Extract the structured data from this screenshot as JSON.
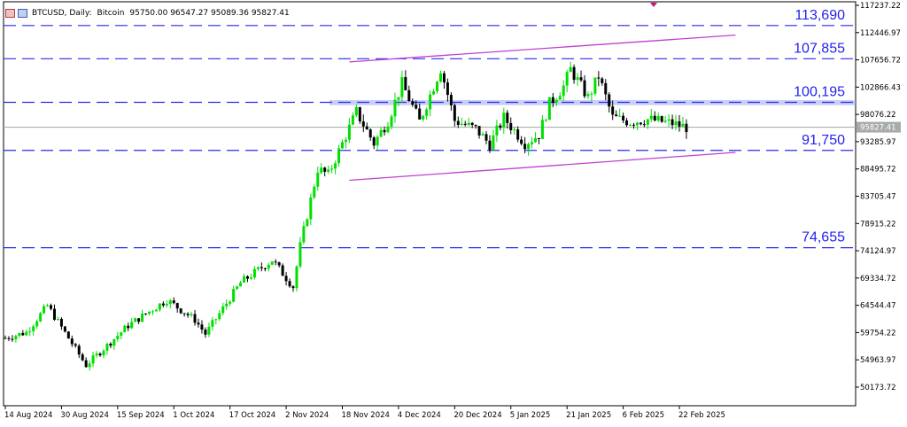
{
  "header": {
    "symbol": "BTCUSD, Daily:",
    "description": "Bitcoin",
    "ohlc": "95750.00 96547.27 95089.36 95827.41"
  },
  "current_price_label": "95827.41",
  "colors": {
    "bull": "#00e000",
    "bear": "#000000",
    "level_line": "#2a2aee",
    "channel": "#c040d0",
    "zone": "#9aa8f0",
    "level_text": "#2222ee",
    "current_line": "#a0a8a0"
  },
  "chart_data": {
    "type": "candlestick",
    "y_axis": {
      "scale": "linear",
      "range": [
        46900,
        117237.22
      ],
      "ticks": [
        "117237.22",
        "112446.97",
        "107656.72",
        "102866.43",
        "98076.22",
        "93285.97",
        "88495.72",
        "83705.47",
        "78915.22",
        "74124.97",
        "69334.72",
        "64544.47",
        "59754.22",
        "54963.97",
        "50173.72"
      ]
    },
    "x_axis": {
      "ticks": [
        "14 Aug 2024",
        "30 Aug 2024",
        "15 Sep 2024",
        "1 Oct 2024",
        "17 Oct 2024",
        "2 Nov 2024",
        "18 Nov 2024",
        "4 Dec 2024",
        "20 Dec 2024",
        "5 Jan 2025",
        "21 Jan 2025",
        "6 Feb 2025",
        "22 Feb 2025"
      ]
    },
    "levels": [
      {
        "label": "113,690",
        "value": 113690
      },
      {
        "label": "107,855",
        "value": 107855
      },
      {
        "label": "100,195",
        "value": 100195
      },
      {
        "label": "91,750",
        "value": 91750
      },
      {
        "label": "74,655",
        "value": 74655
      }
    ],
    "resistance_zone": [
      99700,
      100600
    ],
    "current_price": 95827.41,
    "channel": [
      {
        "from": [
          "2024-11-20",
          107300
        ],
        "to": [
          "2025-03-10",
          112000
        ]
      },
      {
        "from": [
          "2024-11-20",
          86500
        ],
        "to": [
          "2025-03-10",
          91400
        ]
      }
    ],
    "closes_anchor": [
      [
        "2024-08-14",
        58800
      ],
      [
        "2024-08-20",
        59800
      ],
      [
        "2024-08-26",
        64500
      ],
      [
        "2024-09-06",
        54000
      ],
      [
        "2024-09-18",
        61000
      ],
      [
        "2024-09-29",
        65500
      ],
      [
        "2024-10-07",
        62000
      ],
      [
        "2024-10-10",
        59500
      ],
      [
        "2024-10-20",
        68500
      ],
      [
        "2024-10-29",
        72500
      ],
      [
        "2024-11-04",
        67800
      ],
      [
        "2024-11-06",
        75000
      ],
      [
        "2024-11-11",
        88500
      ],
      [
        "2024-11-14",
        87500
      ],
      [
        "2024-11-22",
        98500
      ],
      [
        "2024-11-27",
        93000
      ],
      [
        "2024-12-01",
        97000
      ],
      [
        "2024-12-05",
        103500
      ],
      [
        "2024-12-10",
        96800
      ],
      [
        "2024-12-16",
        106200
      ],
      [
        "2024-12-20",
        97000
      ],
      [
        "2024-12-26",
        95500
      ],
      [
        "2024-12-30",
        92800
      ],
      [
        "2025-01-03",
        97500
      ],
      [
        "2025-01-09",
        93000
      ],
      [
        "2025-01-13",
        94500
      ],
      [
        "2025-01-16",
        100000
      ],
      [
        "2025-01-20",
        103000
      ],
      [
        "2025-01-22",
        106000
      ],
      [
        "2025-01-27",
        101000
      ],
      [
        "2025-01-30",
        104800
      ],
      [
        "2025-02-03",
        97500
      ],
      [
        "2025-02-08",
        96800
      ],
      [
        "2025-02-13",
        97200
      ],
      [
        "2025-02-20",
        96500
      ],
      [
        "2025-02-24",
        95827.41
      ]
    ]
  }
}
